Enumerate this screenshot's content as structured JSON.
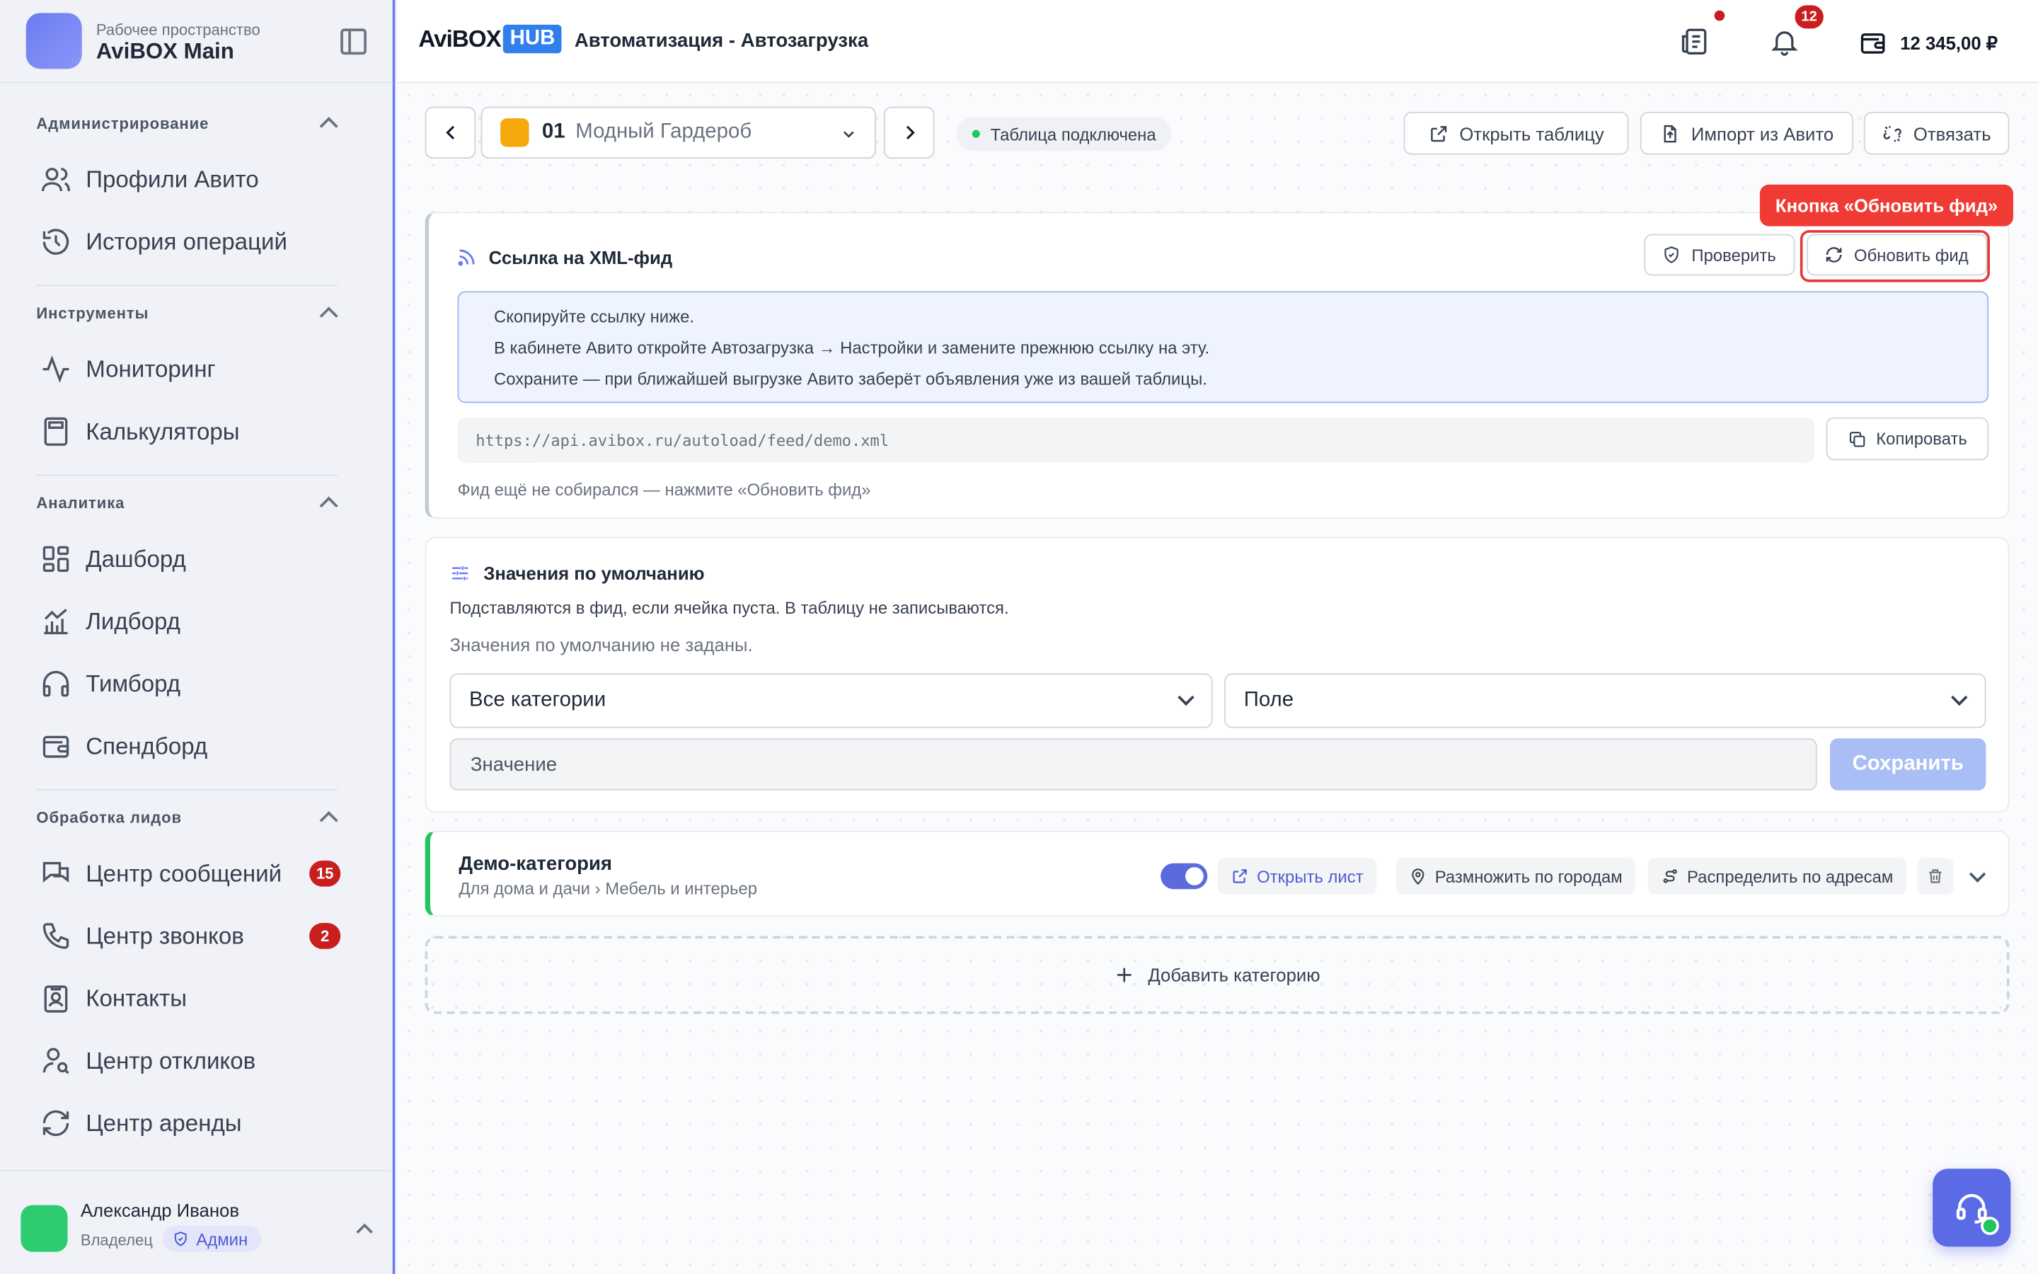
{
  "workspace": {
    "subtitle": "Рабочее пространство",
    "name": "AviBOX Main"
  },
  "sidebar": {
    "sections": [
      {
        "title": "Администрирование",
        "items": [
          {
            "label": "Профили Авито",
            "icon": "users-icon"
          },
          {
            "label": "История операций",
            "icon": "history-icon"
          }
        ]
      },
      {
        "title": "Инструменты",
        "items": [
          {
            "label": "Мониторинг",
            "icon": "activity-icon"
          },
          {
            "label": "Калькуляторы",
            "icon": "calculator-icon"
          }
        ]
      },
      {
        "title": "Аналитика",
        "items": [
          {
            "label": "Дашборд",
            "icon": "dashboard-icon"
          },
          {
            "label": "Лидборд",
            "icon": "chart-icon"
          },
          {
            "label": "Тимборд",
            "icon": "headphones-icon"
          },
          {
            "label": "Спендборд",
            "icon": "wallet-icon"
          }
        ]
      },
      {
        "title": "Обработка лидов",
        "items": [
          {
            "label": "Центр сообщений",
            "icon": "messages-icon",
            "badge": "15"
          },
          {
            "label": "Центр звонков",
            "icon": "phone-icon",
            "badge": "2"
          },
          {
            "label": "Контакты",
            "icon": "contact-icon"
          },
          {
            "label": "Центр откликов",
            "icon": "user-search-icon"
          },
          {
            "label": "Центр аренды",
            "icon": "refresh-icon"
          }
        ]
      }
    ]
  },
  "user": {
    "name": "Александр Иванов",
    "role": "Владелец",
    "badge": "Админ"
  },
  "topbar": {
    "brand_main": "AviBOX",
    "brand_hub": "HUB",
    "title": "Автоматизация - Автозагрузка",
    "notification_count": "12",
    "balance": "12 345,00 ₽"
  },
  "profile": {
    "number": "01",
    "name": "Модный Гардероб"
  },
  "connection_status": "Таблица подключена",
  "actions": {
    "open_table": "Открыть таблицу",
    "import_avito": "Импорт из Авито",
    "unlink": "Отвязать"
  },
  "xml_feed": {
    "title": "Ссылка на XML-фид",
    "check_label": "Проверить",
    "refresh_label": "Обновить фид",
    "info_lines": [
      "Скопируйте ссылку ниже.",
      "В кабинете Авито откройте Автозагрузка → Настройки и замените прежнюю ссылку на эту.",
      "Сохраните — при ближайшей выгрузке Авито заберёт объявления уже из вашей таблицы."
    ],
    "url": "https://api.avibox.ru/autoload/feed/demo.xml",
    "copy_label": "Копировать",
    "hint": "Фид ещё не собирался — нажмите «Обновить фид»"
  },
  "callout": "Кнопка «Обновить фид»",
  "defaults": {
    "title": "Значения по умолчанию",
    "subtitle": "Подставляются в фид, если ячейка пуста. В таблицу не записываются.",
    "empty": "Значения по умолчанию не заданы.",
    "category_select": "Все категории",
    "field_select": "Поле",
    "value_placeholder": "Значение",
    "save_label": "Сохранить"
  },
  "category": {
    "title": "Демо-категория",
    "path": "Для дома и дачи › Мебель и интерьер",
    "enabled": true,
    "open_sheet": "Открыть лист",
    "multiply": "Размножить по городам",
    "distribute": "Распределить по адресам"
  },
  "add_category": "Добавить категорию",
  "colors": {
    "accent": "#5b6be6",
    "brand_hub": "#2f80ed",
    "danger": "#c81e1e",
    "success": "#22c55e",
    "callout": "#ef3b34"
  }
}
